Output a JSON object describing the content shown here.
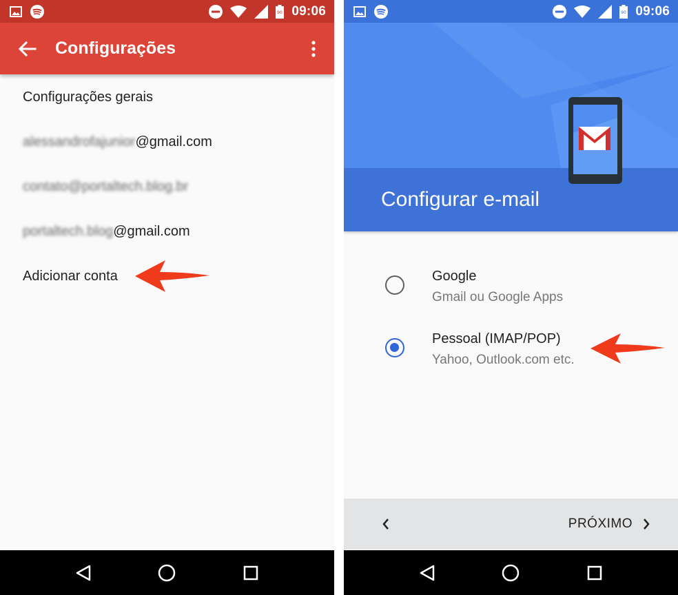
{
  "status_bar": {
    "time": "09:06",
    "battery_level": "90"
  },
  "left_screen": {
    "toolbar": {
      "title": "Configurações",
      "back_icon": "arrow-back-icon",
      "menu_icon": "more-vert-icon"
    },
    "items": [
      {
        "text": "Configurações gerais"
      },
      {
        "prefix_blurred": "alessandrofajunior",
        "suffix": "@gmail.com"
      },
      {
        "prefix_blurred": "contato@portaltech.blog.br",
        "suffix": ""
      },
      {
        "prefix_blurred": "portaltech.blog",
        "suffix": "@gmail.com"
      },
      {
        "text": "Adicionar conta"
      }
    ]
  },
  "right_screen": {
    "header_title": "Configurar e-mail",
    "options": [
      {
        "title": "Google",
        "subtitle": "Gmail ou Google Apps",
        "selected": false
      },
      {
        "title": "Pessoal (IMAP/POP)",
        "subtitle": "Yahoo, Outlook.com etc.",
        "selected": true
      }
    ],
    "footer": {
      "prev_icon": "chevron-left-icon",
      "next_label": "PRÓXIMO",
      "next_icon": "chevron-right-icon"
    }
  },
  "colors": {
    "gmail_red": "#db4437",
    "status_red": "#c2352a",
    "blue": "#4e8cf0",
    "radio_blue": "#2f66d8",
    "arrow": "#f03a1c"
  }
}
